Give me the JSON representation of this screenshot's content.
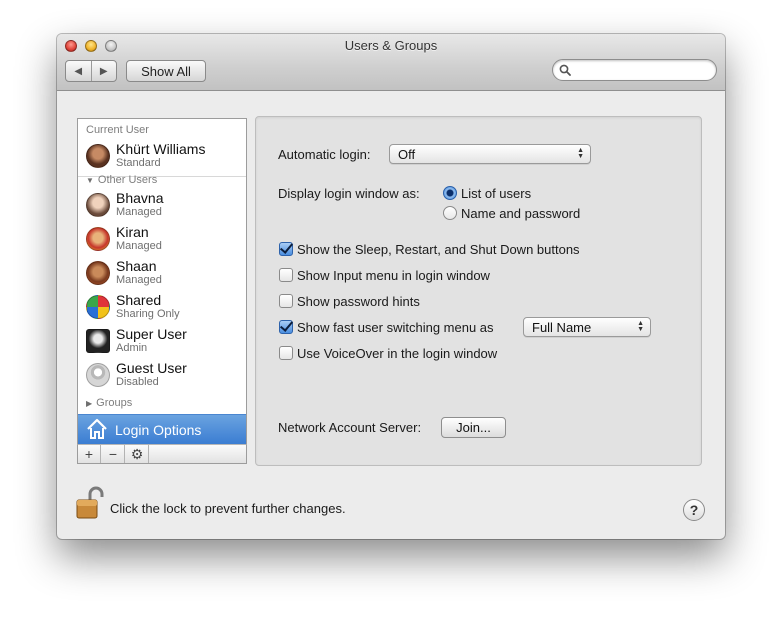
{
  "window": {
    "title": "Users & Groups",
    "nav_back_icon": "chevron-left-icon",
    "nav_forward_icon": "chevron-right-icon",
    "show_all_label": "Show All",
    "search_placeholder": ""
  },
  "sidebar": {
    "current_user_header": "Current User",
    "other_users_header": "Other Users",
    "current_user": {
      "name": "Khürt Williams",
      "role": "Standard",
      "avatar_color": "#7a4a2e"
    },
    "other_users": [
      {
        "name": "Bhavna",
        "role": "Managed",
        "avatar_color": "#b98b6c"
      },
      {
        "name": "Kiran",
        "role": "Managed",
        "avatar_color": "#d9a13a"
      },
      {
        "name": "Shaan",
        "role": "Managed",
        "avatar_color": "#8a4a2a"
      },
      {
        "name": "Shared",
        "role": "Sharing Only",
        "avatar_color": "#e0343a"
      },
      {
        "name": "Super User",
        "role": "Admin",
        "avatar_color": "#222222"
      },
      {
        "name": "Guest User",
        "role": "Disabled",
        "avatar_color": "#b5b5b5"
      }
    ],
    "groups_label": "Groups",
    "login_options_label": "Login Options",
    "toolbar": {
      "add": "+",
      "remove": "−",
      "action_icon": "gear-icon"
    }
  },
  "panel": {
    "automatic_login_label": "Automatic login:",
    "automatic_login_value": "Off",
    "display_login_label": "Display login window as:",
    "radio_options": [
      {
        "label": "List of users",
        "selected": true
      },
      {
        "label": "Name and password",
        "selected": false
      }
    ],
    "checkboxes": [
      {
        "label": "Show the Sleep, Restart, and Shut Down buttons",
        "checked": true
      },
      {
        "label": "Show Input menu in login window",
        "checked": false
      },
      {
        "label": "Show password hints",
        "checked": false
      },
      {
        "label": "Show fast user switching menu as",
        "checked": true
      },
      {
        "label": "Use VoiceOver in the login window",
        "checked": false
      }
    ],
    "fast_switch_value": "Full Name",
    "network_server_label": "Network Account Server:",
    "join_label": "Join..."
  },
  "footer": {
    "lock_text": "Click the lock to prevent further changes.",
    "help_label": "?"
  },
  "colors": {
    "selection": "#3b7dd2",
    "window_bg": "#ececec"
  }
}
